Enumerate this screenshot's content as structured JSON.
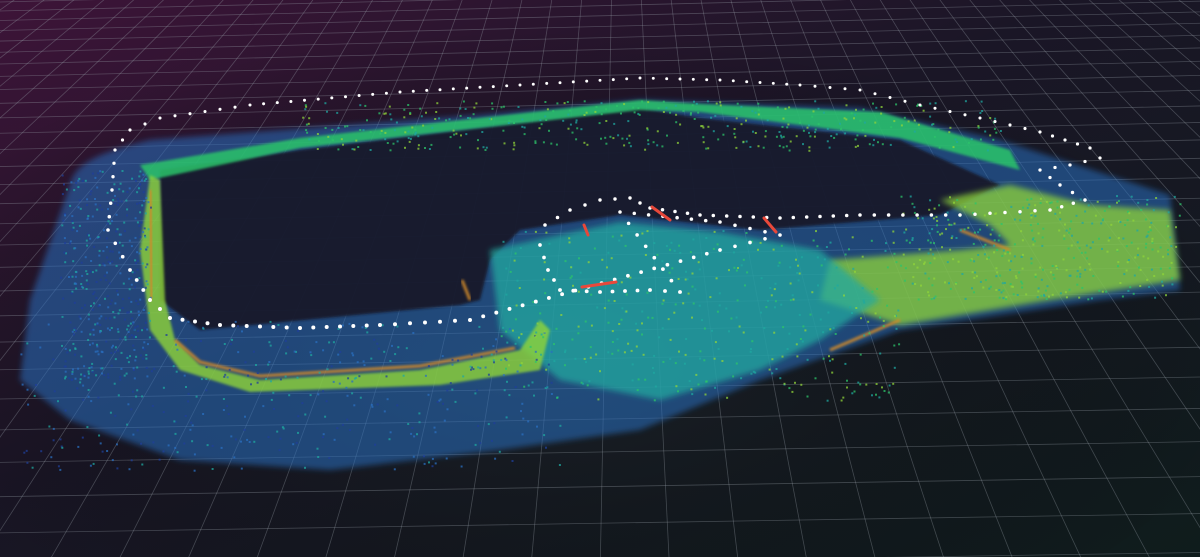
{
  "scene": {
    "kind": "3d-lidar-point-cloud-map",
    "background_gradient": [
      "#3a1436",
      "#1a1626",
      "#111a1c"
    ],
    "grid_color": "#9aa3ad",
    "height_colormap": [
      "#1f3f9a",
      "#2a6fc0",
      "#1fa8a0",
      "#2cc46a",
      "#8fd43a",
      "#d08a2a",
      "#c8302a"
    ],
    "trajectory_color": "#ffffff",
    "marker_color": "#e8483a",
    "elements": {
      "grid": "ground-grid",
      "point_cloud": "lidar-point-cloud",
      "trajectory": "sensor-trajectory",
      "markers": "pose-markers"
    }
  }
}
